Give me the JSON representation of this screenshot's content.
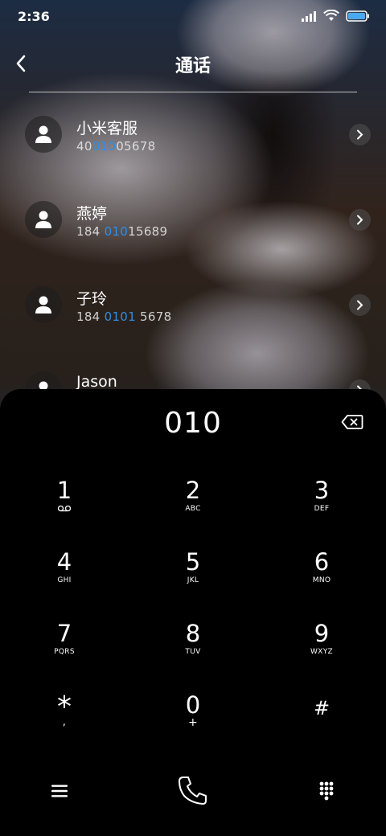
{
  "status_bar": {
    "time": "2:36",
    "icons": [
      "signal-icon",
      "wifi-icon",
      "battery-icon"
    ]
  },
  "header": {
    "title": "通话",
    "back_icon": "chevron-left-icon"
  },
  "contacts": [
    {
      "name": "小米客服",
      "number_pre": "40",
      "number_hl": "010",
      "number_post": "05678"
    },
    {
      "name": "燕婷",
      "number_pre": "184 ",
      "number_hl": "010",
      "number_post": "15689"
    },
    {
      "name": "子玲",
      "number_pre": "184 ",
      "number_hl": "0101",
      "number_post": " 5678"
    },
    {
      "name": "Jason",
      "number_pre": "",
      "number_hl": "",
      "number_post": ""
    }
  ],
  "colors": {
    "highlight": "#2e8ee6",
    "dialer_bg": "#000000"
  },
  "dialer": {
    "display": "010",
    "keys": [
      {
        "digit": "1",
        "letters": ""
      },
      {
        "digit": "2",
        "letters": "ABC"
      },
      {
        "digit": "3",
        "letters": "DEF"
      },
      {
        "digit": "4",
        "letters": "GHI"
      },
      {
        "digit": "5",
        "letters": "JKL"
      },
      {
        "digit": "6",
        "letters": "MNO"
      },
      {
        "digit": "7",
        "letters": "PQRS"
      },
      {
        "digit": "8",
        "letters": "TUV"
      },
      {
        "digit": "9",
        "letters": "WXYZ"
      },
      {
        "digit": "*",
        "letters": ","
      },
      {
        "digit": "0",
        "letters": "+"
      },
      {
        "digit": "#",
        "letters": ""
      }
    ]
  },
  "bottom_bar": {
    "icons": [
      "menu-icon",
      "call-icon",
      "dialpad-icon"
    ]
  }
}
